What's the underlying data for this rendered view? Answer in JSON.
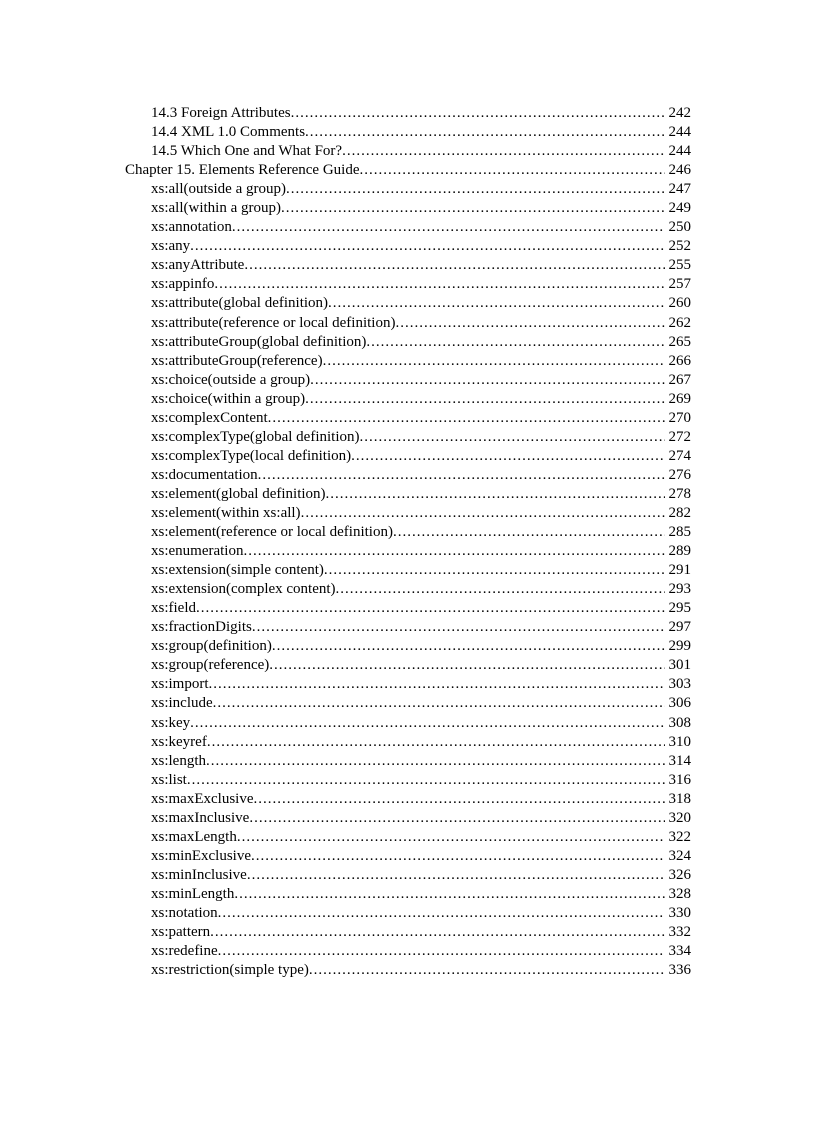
{
  "toc": [
    {
      "level": 1,
      "title": "14.3 Foreign Attributes",
      "page": "242"
    },
    {
      "level": 1,
      "title": "14.4 XML 1.0 Comments",
      "page": "244"
    },
    {
      "level": 1,
      "title": "14.5 Which One and What For?",
      "page": "244"
    },
    {
      "level": 0,
      "title": "Chapter 15. Elements Reference Guide",
      "page": "246"
    },
    {
      "level": 1,
      "title": "xs:all(outside a group)",
      "page": "247"
    },
    {
      "level": 1,
      "title": "xs:all(within a group)",
      "page": "249"
    },
    {
      "level": 1,
      "title": "xs:annotation",
      "page": "250"
    },
    {
      "level": 1,
      "title": "xs:any",
      "page": "252"
    },
    {
      "level": 1,
      "title": "xs:anyAttribute",
      "page": "255"
    },
    {
      "level": 1,
      "title": "xs:appinfo",
      "page": "257"
    },
    {
      "level": 1,
      "title": "xs:attribute(global definition)",
      "page": "260"
    },
    {
      "level": 1,
      "title": "xs:attribute(reference or local definition)",
      "page": "262"
    },
    {
      "level": 1,
      "title": "xs:attributeGroup(global definition)",
      "page": "265"
    },
    {
      "level": 1,
      "title": "xs:attributeGroup(reference)",
      "page": "266"
    },
    {
      "level": 1,
      "title": "xs:choice(outside a group)",
      "page": "267"
    },
    {
      "level": 1,
      "title": "xs:choice(within a group)",
      "page": "269"
    },
    {
      "level": 1,
      "title": "xs:complexContent",
      "page": "270"
    },
    {
      "level": 1,
      "title": "xs:complexType(global definition)",
      "page": "272"
    },
    {
      "level": 1,
      "title": "xs:complexType(local definition)",
      "page": "274"
    },
    {
      "level": 1,
      "title": "xs:documentation",
      "page": "276"
    },
    {
      "level": 1,
      "title": "xs:element(global definition)",
      "page": "278"
    },
    {
      "level": 1,
      "title": "xs:element(within xs:all)",
      "page": "282"
    },
    {
      "level": 1,
      "title": "xs:element(reference or local definition)",
      "page": "285"
    },
    {
      "level": 1,
      "title": "xs:enumeration",
      "page": "289"
    },
    {
      "level": 1,
      "title": "xs:extension(simple content)",
      "page": "291"
    },
    {
      "level": 1,
      "title": "xs:extension(complex content)",
      "page": "293"
    },
    {
      "level": 1,
      "title": "xs:field",
      "page": "295"
    },
    {
      "level": 1,
      "title": "xs:fractionDigits",
      "page": "297"
    },
    {
      "level": 1,
      "title": "xs:group(definition)",
      "page": "299"
    },
    {
      "level": 1,
      "title": "xs:group(reference)",
      "page": "301"
    },
    {
      "level": 1,
      "title": "xs:import",
      "page": "303"
    },
    {
      "level": 1,
      "title": "xs:include",
      "page": "306"
    },
    {
      "level": 1,
      "title": "xs:key",
      "page": "308"
    },
    {
      "level": 1,
      "title": "xs:keyref",
      "page": "310"
    },
    {
      "level": 1,
      "title": "xs:length",
      "page": "314"
    },
    {
      "level": 1,
      "title": "xs:list",
      "page": "316"
    },
    {
      "level": 1,
      "title": "xs:maxExclusive",
      "page": "318"
    },
    {
      "level": 1,
      "title": "xs:maxInclusive",
      "page": "320"
    },
    {
      "level": 1,
      "title": "xs:maxLength",
      "page": "322"
    },
    {
      "level": 1,
      "title": "xs:minExclusive",
      "page": "324"
    },
    {
      "level": 1,
      "title": "xs:minInclusive",
      "page": "326"
    },
    {
      "level": 1,
      "title": "xs:minLength",
      "page": "328"
    },
    {
      "level": 1,
      "title": "xs:notation",
      "page": "330"
    },
    {
      "level": 1,
      "title": "xs:pattern",
      "page": "332"
    },
    {
      "level": 1,
      "title": "xs:redefine",
      "page": "334"
    },
    {
      "level": 1,
      "title": "xs:restriction(simple type)",
      "page": "336"
    }
  ]
}
